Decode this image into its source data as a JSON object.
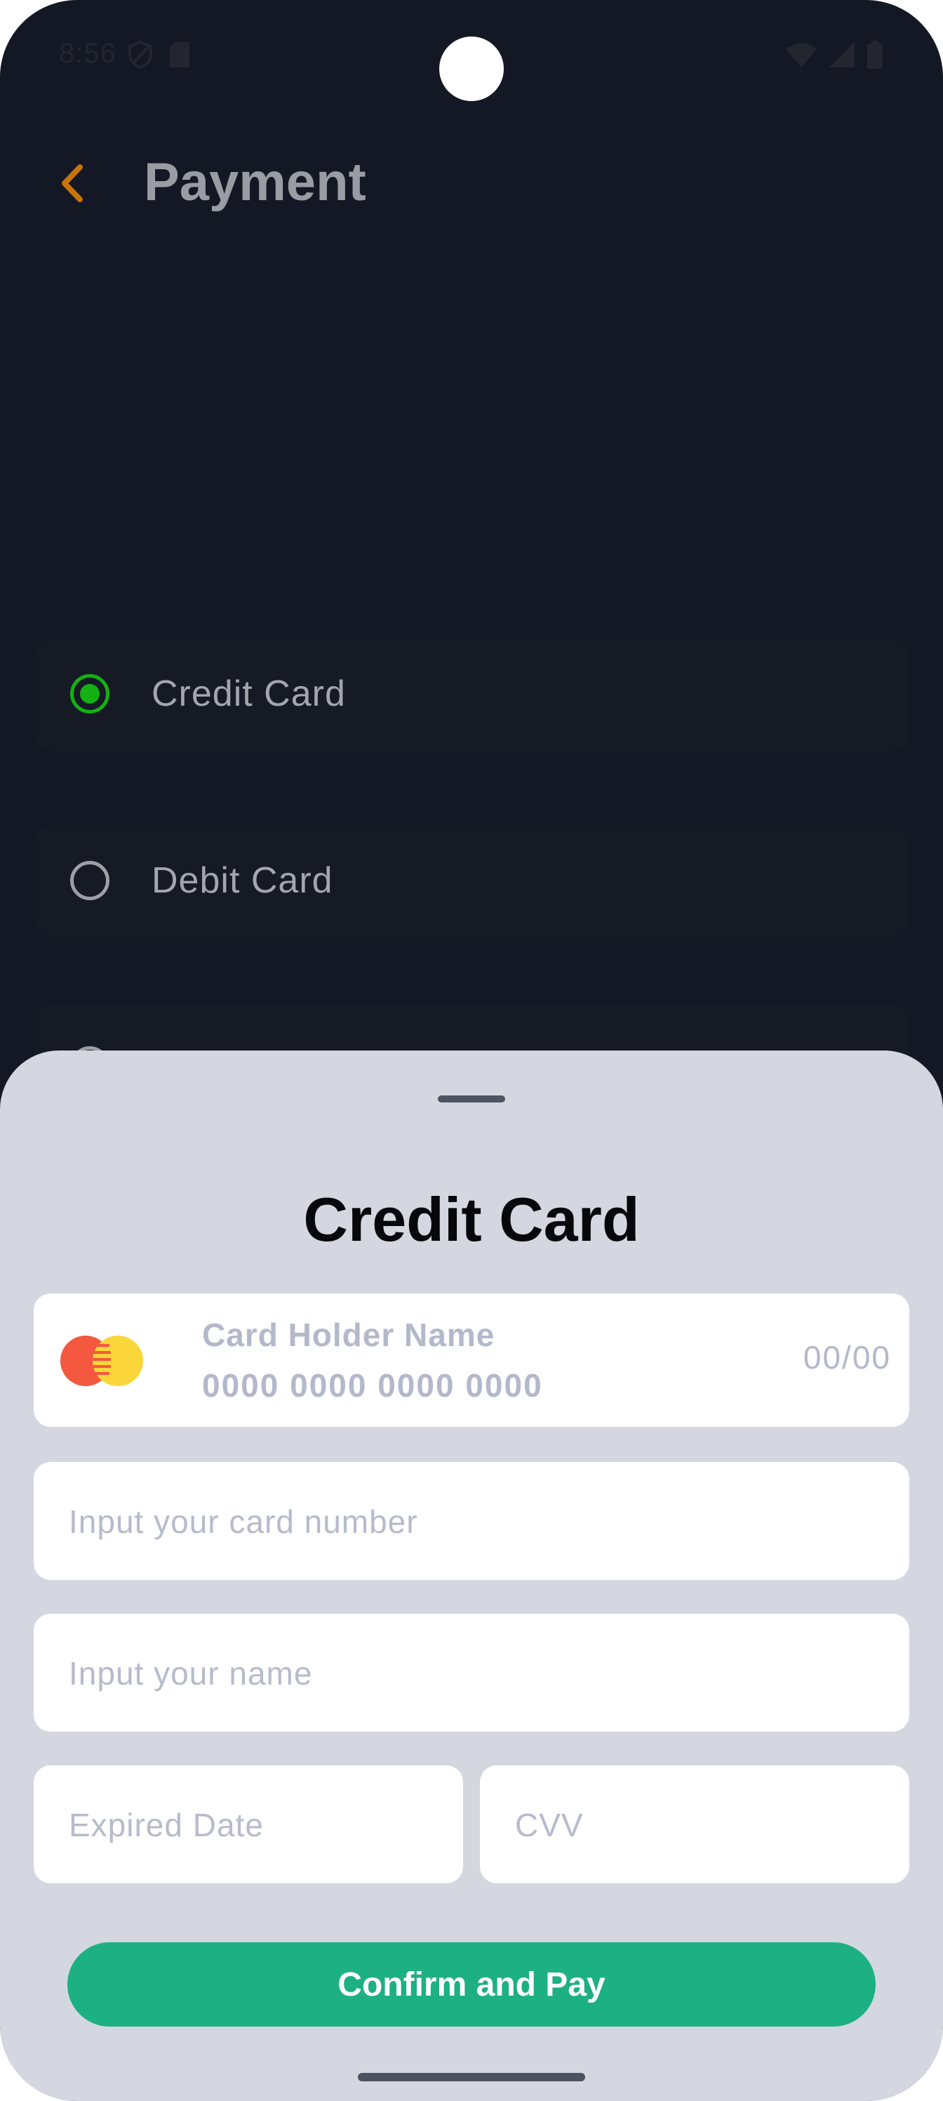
{
  "status_bar": {
    "time": "8:56",
    "left_icons": [
      "vpn-shield-icon",
      "sd-card-icon"
    ],
    "right_icons": [
      "wifi-icon",
      "signal-icon",
      "battery-icon"
    ]
  },
  "app_bar": {
    "back_icon": "chevron-left-icon",
    "title": "Payment",
    "accent_color": "#c8730c"
  },
  "payment_options": [
    {
      "label": "Credit Card",
      "selected": true
    },
    {
      "label": "Debit Card",
      "selected": false
    }
  ],
  "sheet": {
    "title": "Credit Card",
    "card_preview": {
      "holder_placeholder": "Card Holder Name",
      "number_placeholder": "0000 0000 0000 0000",
      "expiry_placeholder": "00/00",
      "brand_icon": "mastercard-icon"
    },
    "fields": {
      "card_number_placeholder": "Input your card number",
      "name_placeholder": "Input your name",
      "expiry_placeholder": "Expired Date",
      "cvv_placeholder": "CVV"
    },
    "confirm_label": "Confirm and Pay",
    "confirm_color": "#1db082"
  }
}
